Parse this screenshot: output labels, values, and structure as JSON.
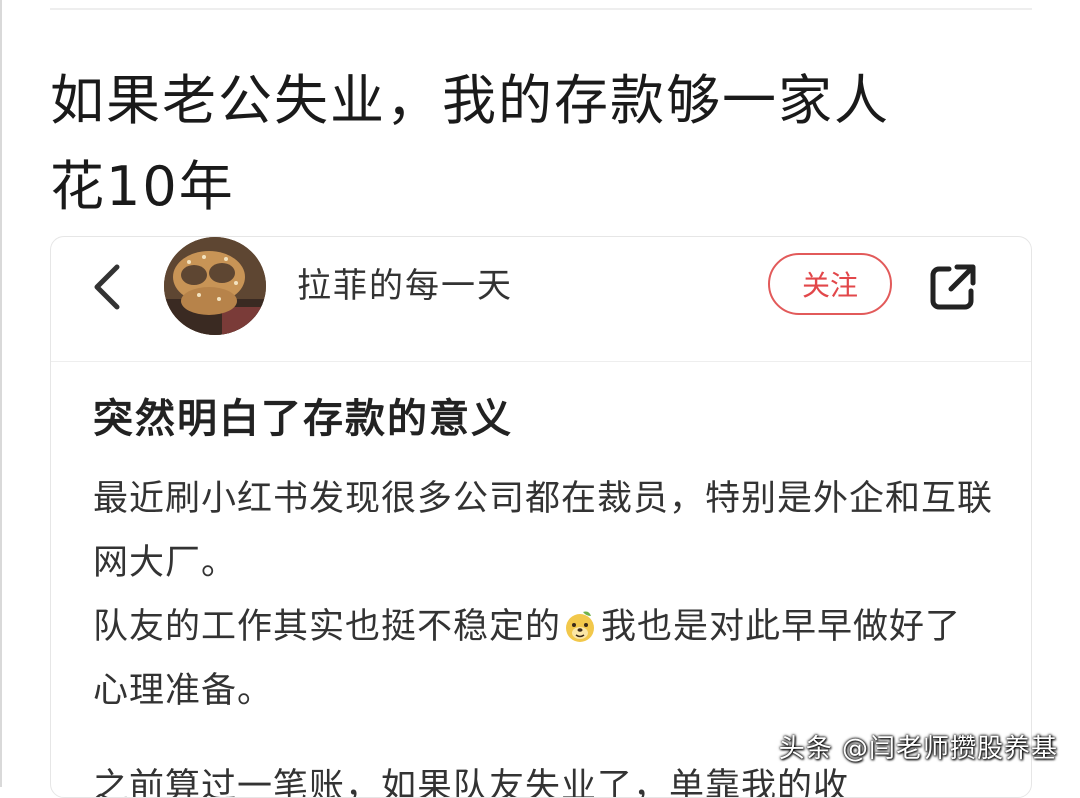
{
  "article": {
    "title_line1": "如果老公失业，我的存款够一家人",
    "title_line2": "花10年"
  },
  "embedded_post": {
    "header": {
      "back_icon": "chevron-left-icon",
      "username": "拉菲的每一天",
      "follow_label": "关注",
      "share_icon": "share-external-icon"
    },
    "title": "突然明白了存款的意义",
    "paragraphs": [
      "最近刷小红书发现很多公司都在裁员，特别是外企和互联网大厂。",
      "队友的工作其实也挺不稳定的",
      "我也是对此早早做好了心理准备。",
      "之前算过一笔账，如果队友失业了，单靠我的收"
    ],
    "emoji_icon": "doge-face-icon"
  },
  "watermark": "头条 @闫老师攒股养基",
  "colors": {
    "follow_accent": "#e2474a",
    "text_primary": "#222222",
    "card_border": "#e6e6e6"
  }
}
